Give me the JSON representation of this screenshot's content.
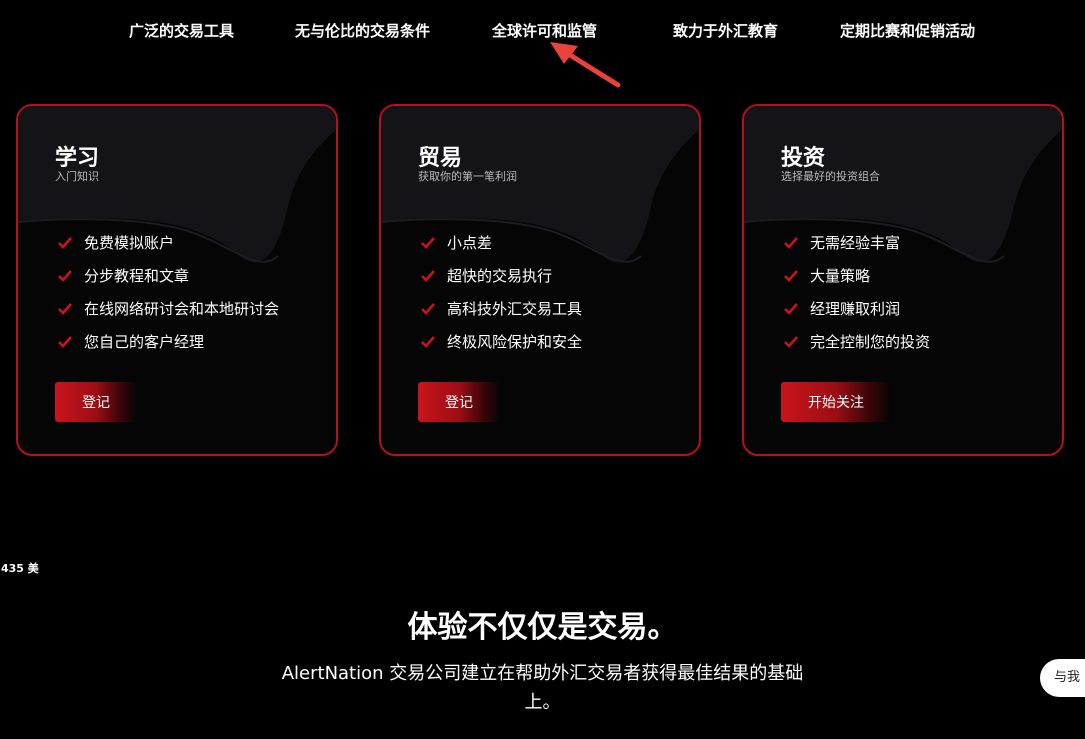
{
  "nav": {
    "items": [
      {
        "label": "广泛的交易工具"
      },
      {
        "label": "无与伦比的交易条件"
      },
      {
        "label": "全球许可和监管"
      },
      {
        "label": "致力于外汇教育"
      },
      {
        "label": "定期比赛和促销活动"
      }
    ]
  },
  "cards": [
    {
      "title": "学习",
      "subtitle": "入门知识",
      "features": [
        "免费模拟账户",
        "分步教程和文章",
        "在线网络研讨会和本地研讨会",
        "您自己的客户经理"
      ],
      "button": "登记"
    },
    {
      "title": "贸易",
      "subtitle": "获取你的第一笔利润",
      "features": [
        "小点差",
        "超快的交易执行",
        "高科技外汇交易工具",
        "终极风险保护和安全"
      ],
      "button": "登记"
    },
    {
      "title": "投资",
      "subtitle": "选择最好的投资组合",
      "features": [
        "无需经验丰富",
        "大量策略",
        "经理赚取利润",
        "完全控制您的投资"
      ],
      "button": "开始关注"
    }
  ],
  "price_ticker": "435 美",
  "hero": {
    "headline": "体验不仅仅是交易。",
    "description": "AlertNation 交易公司建立在帮助外汇交易者获得最佳结果的基础上。"
  },
  "chat": {
    "label": "与我"
  },
  "colors": {
    "accent": "#b3121b",
    "annotation_arrow": "#e8423c"
  },
  "icons": {
    "feature": "check-icon",
    "annotation": "arrow-icon"
  }
}
